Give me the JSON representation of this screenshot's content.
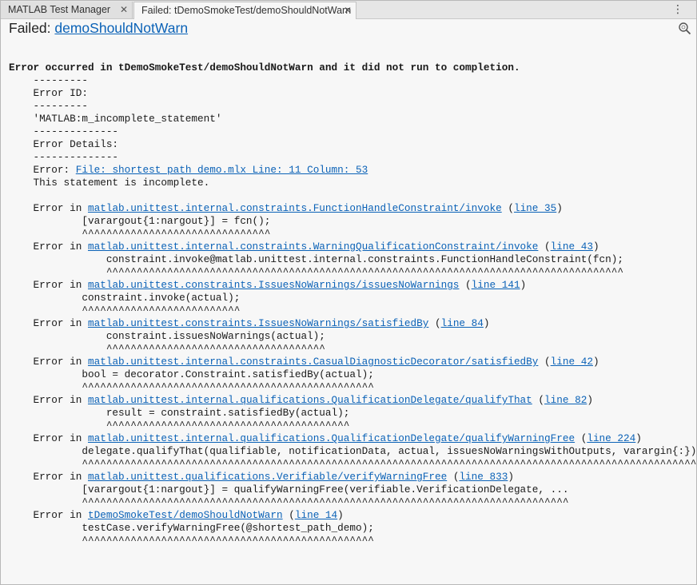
{
  "tabs": [
    {
      "label": "MATLAB Test Manager"
    },
    {
      "label": "Failed: tDemoSmokeTest/demoShouldNotWarn"
    }
  ],
  "header": {
    "prefix": "Failed: ",
    "link": "demoShouldNotWarn"
  },
  "report": {
    "summary": "Error occurred in tDemoSmokeTest/demoShouldNotWarn and it did not run to completion.",
    "sep_short": "    ---------",
    "error_id_label": "    Error ID:",
    "error_id_value": "    'MATLAB:m_incomplete_statement'",
    "sep_long": "    --------------",
    "details_label": "    Error Details:",
    "error_prefix": "    Error: ",
    "error_location": "File: shortest_path_demo.mlx Line: 11 Column: 53",
    "error_message": "    This statement is incomplete.",
    "stack_prefix": "    Error in ",
    "open_paren": " (",
    "close_paren": ")",
    "stack": [
      {
        "func": "matlab.unittest.internal.constraints.FunctionHandleConstraint/invoke",
        "line": "line 35",
        "code": "            [varargout{1:nargout}] = fcn();",
        "caret": "            ^^^^^^^^^^^^^^^^^^^^^^^^^^^^^^^"
      },
      {
        "func": "matlab.unittest.internal.constraints.WarningQualificationConstraint/invoke",
        "line": "line 43",
        "code": "                constraint.invoke@matlab.unittest.internal.constraints.FunctionHandleConstraint(fcn);",
        "caret": "                ^^^^^^^^^^^^^^^^^^^^^^^^^^^^^^^^^^^^^^^^^^^^^^^^^^^^^^^^^^^^^^^^^^^^^^^^^^^^^^^^^^^^^"
      },
      {
        "func": "matlab.unittest.constraints.IssuesNoWarnings/issuesNoWarnings",
        "line": "line 141",
        "code": "            constraint.invoke(actual);",
        "caret": "            ^^^^^^^^^^^^^^^^^^^^^^^^^^"
      },
      {
        "func": "matlab.unittest.constraints.IssuesNoWarnings/satisfiedBy",
        "line": "line 84",
        "code": "                constraint.issuesNoWarnings(actual);",
        "caret": "                ^^^^^^^^^^^^^^^^^^^^^^^^^^^^^^^^^^^^"
      },
      {
        "func": "matlab.unittest.internal.constraints.CasualDiagnosticDecorator/satisfiedBy",
        "line": "line 42",
        "code": "            bool = decorator.Constraint.satisfiedBy(actual);",
        "caret": "            ^^^^^^^^^^^^^^^^^^^^^^^^^^^^^^^^^^^^^^^^^^^^^^^^"
      },
      {
        "func": "matlab.unittest.internal.qualifications.QualificationDelegate/qualifyThat",
        "line": "line 82",
        "code": "                result = constraint.satisfiedBy(actual);",
        "caret": "                ^^^^^^^^^^^^^^^^^^^^^^^^^^^^^^^^^^^^^^^^"
      },
      {
        "func": "matlab.unittest.internal.qualifications.QualificationDelegate/qualifyWarningFree",
        "line": "line 224",
        "code": "            delegate.qualifyThat(qualifiable, notificationData, actual, issuesNoWarningsWithOutputs, varargin{:});",
        "caret": "            ^^^^^^^^^^^^^^^^^^^^^^^^^^^^^^^^^^^^^^^^^^^^^^^^^^^^^^^^^^^^^^^^^^^^^^^^^^^^^^^^^^^^^^^^^^^^^^^^^^^^^^"
      },
      {
        "func": "matlab.unittest.qualifications.Verifiable/verifyWarningFree",
        "line": "line 833",
        "code": "            [varargout{1:nargout}] = qualifyWarningFree(verifiable.VerificationDelegate, ...",
        "caret": "            ^^^^^^^^^^^^^^^^^^^^^^^^^^^^^^^^^^^^^^^^^^^^^^^^^^^^^^^^^^^^^^^^^^^^^^^^^^^^^^^^"
      },
      {
        "func": "tDemoSmokeTest/demoShouldNotWarn",
        "line": "line 14",
        "code": "            testCase.verifyWarningFree(@shortest_path_demo);",
        "caret": "            ^^^^^^^^^^^^^^^^^^^^^^^^^^^^^^^^^^^^^^^^^^^^^^^^"
      }
    ]
  },
  "colors": {
    "link": "#0b62b7",
    "background": "#f7f7f7"
  },
  "icons": {
    "close": "close-icon",
    "menu": "kebab-menu-icon",
    "find": "search-icon"
  }
}
